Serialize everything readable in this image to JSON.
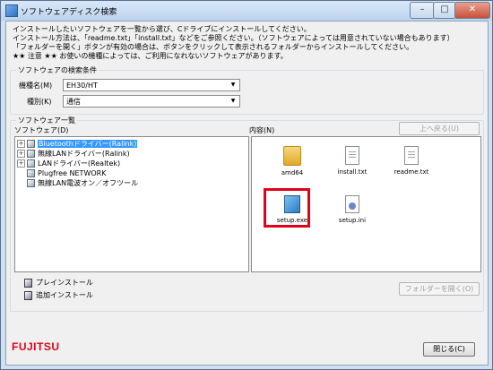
{
  "window": {
    "title": "ソフトウェアディスク検索",
    "controls": {
      "minimize": "–",
      "maximize": "□",
      "close": "✕"
    }
  },
  "intro_lines": [
    "インストールしたいソフトウェアを一覧から選び、Cドライブにインストールしてください。",
    "インストール方法は、「readme.txt」「install.txt」などをご参照ください。（ソフトウェアによっては用意されていない場合もあります）",
    "「フォルダーを開く」ボタンが有効の場合は、ボタンをクリックして表示されるフォルダーからインストールしてください。",
    "★★ 注意 ★★ お使いの機種によっては、ご利用になれないソフトウェアがあります。"
  ],
  "search": {
    "group_label": "ソフトウェアの検索条件",
    "model_label": "機種名(M)",
    "model_value": "EH30/HT",
    "type_label": "種別(K)",
    "type_value": "通信"
  },
  "list": {
    "group_label": "ソフトウェア一覧",
    "software_label": "ソフトウェア(D)",
    "contents_label": "内容(N)",
    "up_button": "上へ戻る(U)",
    "open_folder_button": "フォルダーを開く(O)"
  },
  "tree": [
    {
      "label": "Bluetoothドライバー(Ralink)",
      "expandable": true,
      "selected": true
    },
    {
      "label": "無線LANドライバー(Ralink)",
      "expandable": true,
      "selected": false
    },
    {
      "label": "LANドライバー(Realtek)",
      "expandable": true,
      "selected": false
    },
    {
      "label": "Plugfree NETWORK",
      "expandable": false,
      "selected": false
    },
    {
      "label": "無線LAN電波オン／オフツール",
      "expandable": false,
      "selected": false
    }
  ],
  "files": [
    {
      "name": "amd64",
      "icon": "folder-icon"
    },
    {
      "name": "install.txt",
      "icon": "text-file-icon"
    },
    {
      "name": "readme.txt",
      "icon": "text-file-icon"
    },
    {
      "name": "setup.exe",
      "icon": "setup-exe-icon",
      "highlighted": true
    },
    {
      "name": "setup.ini",
      "icon": "ini-file-icon"
    }
  ],
  "legend": {
    "preinstall": "プレインストール",
    "additional": "追加インストール"
  },
  "logo": "FUJITSU",
  "close_button": "閉じる(C)",
  "colors": {
    "highlight": "#e3001b",
    "selection": "#3399ff",
    "logo": "#e3001b"
  }
}
